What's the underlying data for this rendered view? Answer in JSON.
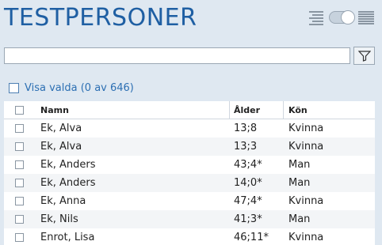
{
  "header": {
    "title": "TESTPERSONER"
  },
  "view_controls": {
    "list_icon": "list-view-icon",
    "toggle_icon": "toggle-icon",
    "grid_icon": "grid-view-icon"
  },
  "search": {
    "value": "",
    "placeholder": ""
  },
  "filter": {
    "icon": "filter-icon"
  },
  "show_selected": {
    "label": "Visa valda (0 av 646)"
  },
  "table": {
    "columns": [
      "Namn",
      "Ålder",
      "Kön"
    ],
    "rows": [
      {
        "name": "Ek, Alva",
        "age": "13;8",
        "sex": "Kvinna"
      },
      {
        "name": "Ek, Alva",
        "age": "13;3",
        "sex": "Kvinna"
      },
      {
        "name": "Ek, Anders",
        "age": "43;4*",
        "sex": "Man"
      },
      {
        "name": "Ek, Anders",
        "age": "14;0*",
        "sex": "Man"
      },
      {
        "name": "Ek, Anna",
        "age": "47;4*",
        "sex": "Kvinna"
      },
      {
        "name": "Ek, Nils",
        "age": "41;3*",
        "sex": "Man"
      },
      {
        "name": "Enrot, Lisa",
        "age": "46;11*",
        "sex": "Kvinna"
      }
    ]
  },
  "colors": {
    "background": "#dfe8f1",
    "title": "#1f5fa3",
    "link": "#2c6fb3"
  }
}
